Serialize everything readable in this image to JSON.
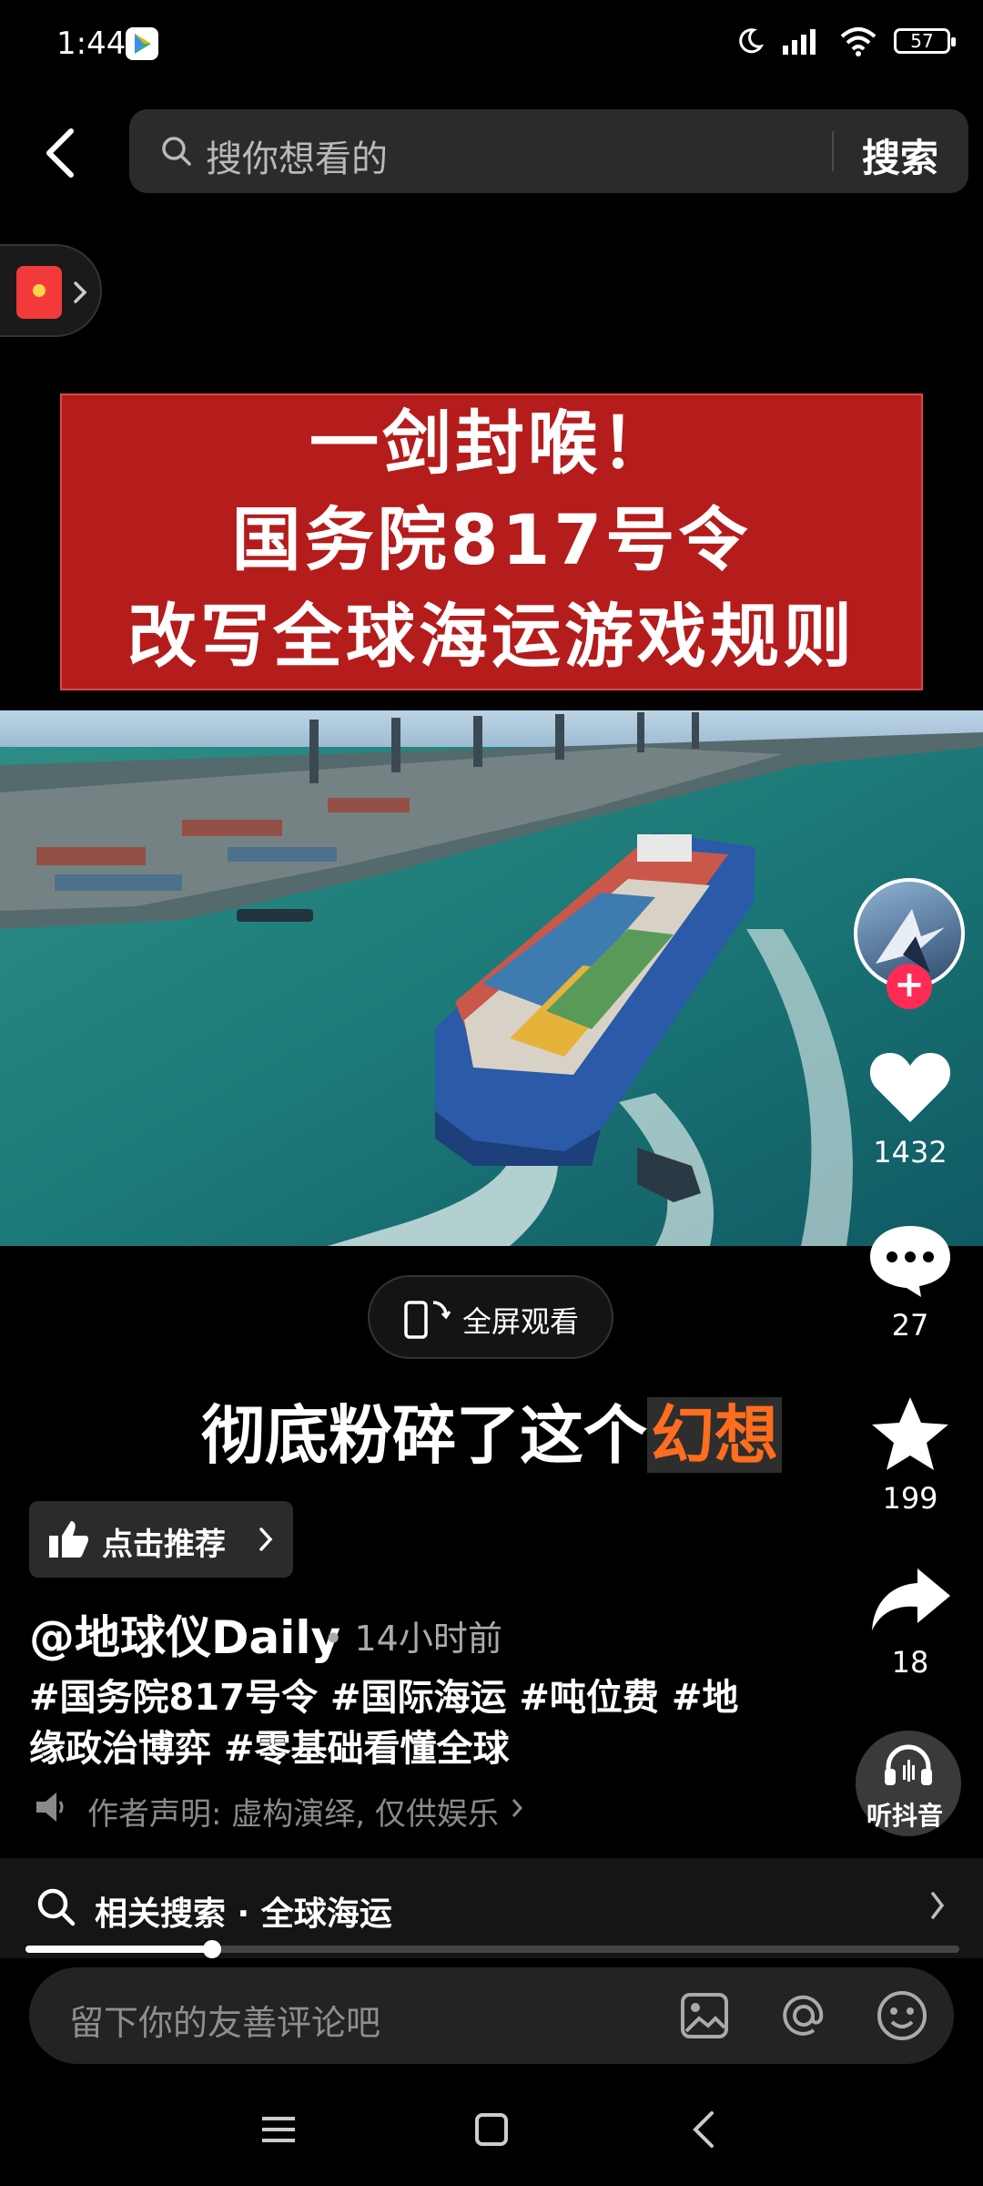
{
  "status_bar": {
    "time": "1:44",
    "battery": "57"
  },
  "search": {
    "placeholder": "搜你想看的",
    "button": "搜索"
  },
  "banner": {
    "lines": [
      "一剑封喉！",
      "国务院817号令",
      "改写全球海运游戏规则"
    ]
  },
  "rail": {
    "likes": "1432",
    "comments": "27",
    "favorites": "199",
    "shares": "18",
    "listen": "听抖音"
  },
  "fullscreen": {
    "label": "全屏观看"
  },
  "caption": {
    "text": "彻底粉碎了这个",
    "highlight": "幻想"
  },
  "recommend": {
    "label": "点击推荐"
  },
  "post": {
    "author": "@地球仪Daily",
    "time": "• 14小时前",
    "tags_line1": "#国务院817号令 #国际海运 #吨位费 #地",
    "tags_line2": "缘政治博弈 #零基础看懂全球",
    "notice": "作者声明: 虚构演绎, 仅供娱乐"
  },
  "related": {
    "label": "相关搜索 · 全球海运"
  },
  "progress": {
    "fraction": 0.2
  },
  "comment": {
    "placeholder": "留下你的友善评论吧"
  },
  "colors": {
    "accent": "#fe2c55",
    "highlight": "#ff6d1f",
    "banner": "#b51c1c"
  }
}
